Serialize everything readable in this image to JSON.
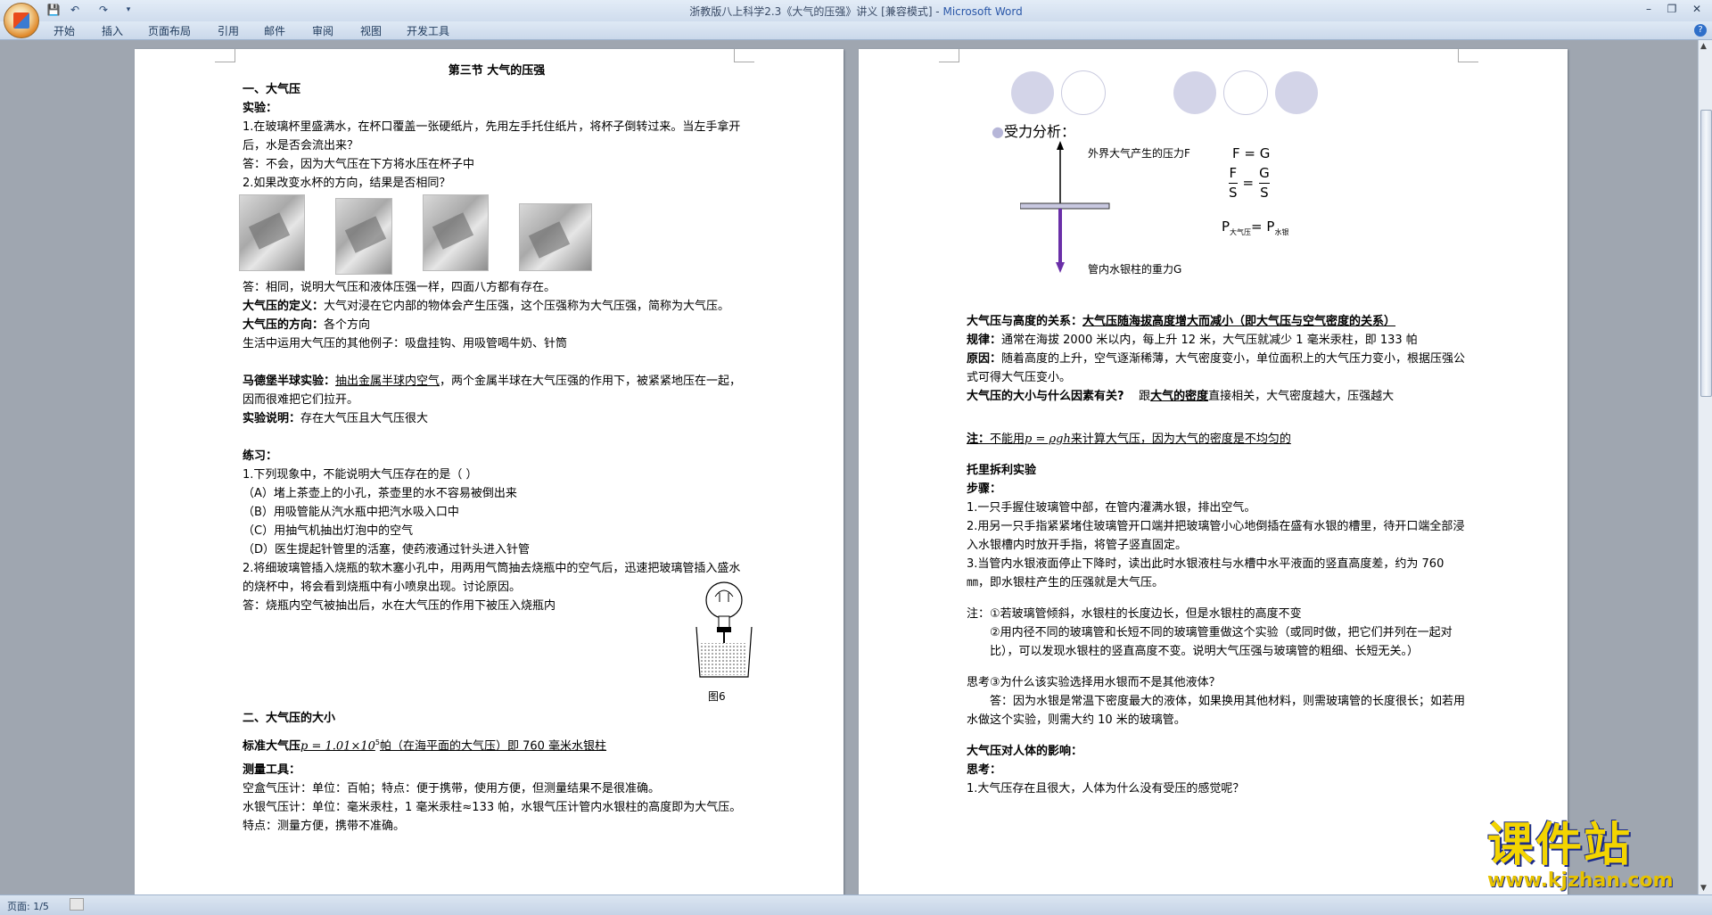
{
  "window": {
    "title_doc": "浙教版八上科学2.3《大气的压强》讲义 [兼容模式] - ",
    "title_app": "Microsoft Word"
  },
  "ribbon": {
    "tabs": [
      "开始",
      "插入",
      "页面布局",
      "引用",
      "邮件",
      "审阅",
      "视图",
      "开发工具"
    ]
  },
  "status": {
    "page": "页面: 1/5"
  },
  "watermark": {
    "cn": "课件站",
    "url": "www.kjzhan.com"
  },
  "left_page": {
    "title": "第三节 大气的压强",
    "s1_heading": "一、大气压",
    "experiment": "实验：",
    "exp_q1": "1.在玻璃杯里盛满水，在杯口覆盖一张硬纸片，先用左手托住纸片，将杯子倒转过来。当左手拿开后，水是否会流出来？",
    "exp_a1": "答：不会，因为大气压在下方将水压在杯子中",
    "exp_q2": "2.如果改变水杯的方向，结果是否相同？",
    "exp_a2": "答：相同，说明大气压和液体压强一样，四面八方都有存在。",
    "def_label": "大气压的定义：",
    "def_text": "大气对浸在它内部的物体会产生压强，这个压强称为大气压强，简称为大气压。",
    "dir_label": "大气压的方向：",
    "dir_text": "各个方向",
    "examples": "生活中运用大气压的其他例子：吸盘挂钩、用吸管喝牛奶、针筒",
    "md_label": "马德堡半球实验：",
    "md_underline": "抽出金属半球内空气",
    "md_text": "，两个金属半球在大气压强的作用下，被紧紧地压在一起，因而很难把它们拉开。",
    "expl_label": "实验说明：",
    "expl_text": "存在大气压且大气压很大",
    "practice": "练习：",
    "p1": "1.下列现象中，不能说明大气压存在的是（    ）",
    "pA": "（A）堵上茶壶上的小孔，茶壶里的水不容易被倒出来",
    "pB": "（B）用吸管能从汽水瓶中把汽水吸入口中",
    "pC": "（C）用抽气机抽出灯泡中的空气",
    "pD": "（D）医生提起针管里的活塞，使药液通过针头进入针管",
    "p2": "2.将细玻璃管插入烧瓶的软木塞小孔中，用两用气筒抽去烧瓶中的空气后，迅速把玻璃管插入盛水的烧杯中，将会看到烧瓶中有小喷泉出现。讨论原因。",
    "p2_answer": "答：烧瓶内空气被抽出后，水在大气压的作用下被压入烧瓶内",
    "fig6": "图6",
    "s2_heading": "二、大气压的大小",
    "std_label": "标准大气压",
    "std_formula": "p = 1.01×10",
    "std_exp": "5",
    "std_text": "帕（在海平面的大气压）即 760 毫米水银柱",
    "tools_label": "测量工具：",
    "tool1": "空盒气压计：单位：百帕；特点：便于携带，使用方便，但测量结果不是很准确。",
    "tool2": "水银气压计：单位：毫米汞柱，1 毫米汞柱≈133 帕，水银气压计管内水银柱的高度即为大气压。特点：测量方便，携带不准确。"
  },
  "right_page": {
    "force_title": "受力分析：",
    "f_up_label": "外界大气产生的压力F",
    "f_down_label": "管内水银柱的重力G",
    "eq1": "F = G",
    "eq2_num_l": "F",
    "eq2_den_l": "S",
    "eq2_num_r": "G",
    "eq2_den_r": "S",
    "eq3_p1": "P",
    "eq3_sub1": "大气压",
    "eq3_eq": "=",
    "eq3_p2": "P",
    "eq3_sub2": "水银",
    "alt_label": "大气压与高度的关系：",
    "alt_text": "大气压随海拔高度增大而减小（即大气压与空气密度的关系）",
    "rule_label": "规律：",
    "rule_text": "通常在海拔 2000 米以内，每上升 12 米，大气压就减少 1 毫米汞柱，即 133 帕",
    "reason_label": "原因：",
    "reason_text": "随着高度的上升，空气逐渐稀薄，大气密度变小，单位面积上的大气压力变小，根据压强公式可得大气压变小。",
    "factor_label": "大气压的大小与什么因素有关?",
    "factor_pre": "跟",
    "factor_u": "大气的密度",
    "factor_text": "直接相关，大气密度越大，压强越大",
    "note_label": "注：",
    "note_text1": "不能用",
    "note_formula": "p = ρgh",
    "note_text2": "来计算大气压，因为大气的密度是不均匀的",
    "torr_heading": "托里拆利实验",
    "steps_label": "步骤：",
    "step1": "1.一只手握住玻璃管中部，在管内灌满水银，排出空气。",
    "step2": "2.用另一只手指紧紧堵住玻璃管开口端并把玻璃管小心地倒插在盛有水银的槽里，待开口端全部浸入水银槽内时放开手指，将管子竖直固定。",
    "step3": "3.当管内水银液面停止下降时，读出此时水银液柱与水槽中水平液面的竖直高度差，约为 760㎜，即水银柱产生的压强就是大气压。",
    "note2_1": "注：①若玻璃管倾斜，水银柱的长度边长，但是水银柱的高度不变",
    "note2_2": "②用内径不同的玻璃管和长短不同的玻璃管重做这个实验（或同时做，把它们并列在一起对比），可以发现水银柱的竖直高度不变。说明大气压强与玻璃管的粗细、长短无关。）",
    "think3": "思考③为什么该实验选择用水银而不是其他液体？",
    "think3_ans": "答：因为水银是常温下密度最大的液体，如果换用其他材料，则需玻璃管的长度很长；如若用水做这个实验，则需大约 10 米的玻璃管。",
    "body_heading": "大气压对人体的影响：",
    "think_label": "思考：",
    "think1": "1.大气压存在且很大，人体为什么没有受压的感觉呢？"
  }
}
